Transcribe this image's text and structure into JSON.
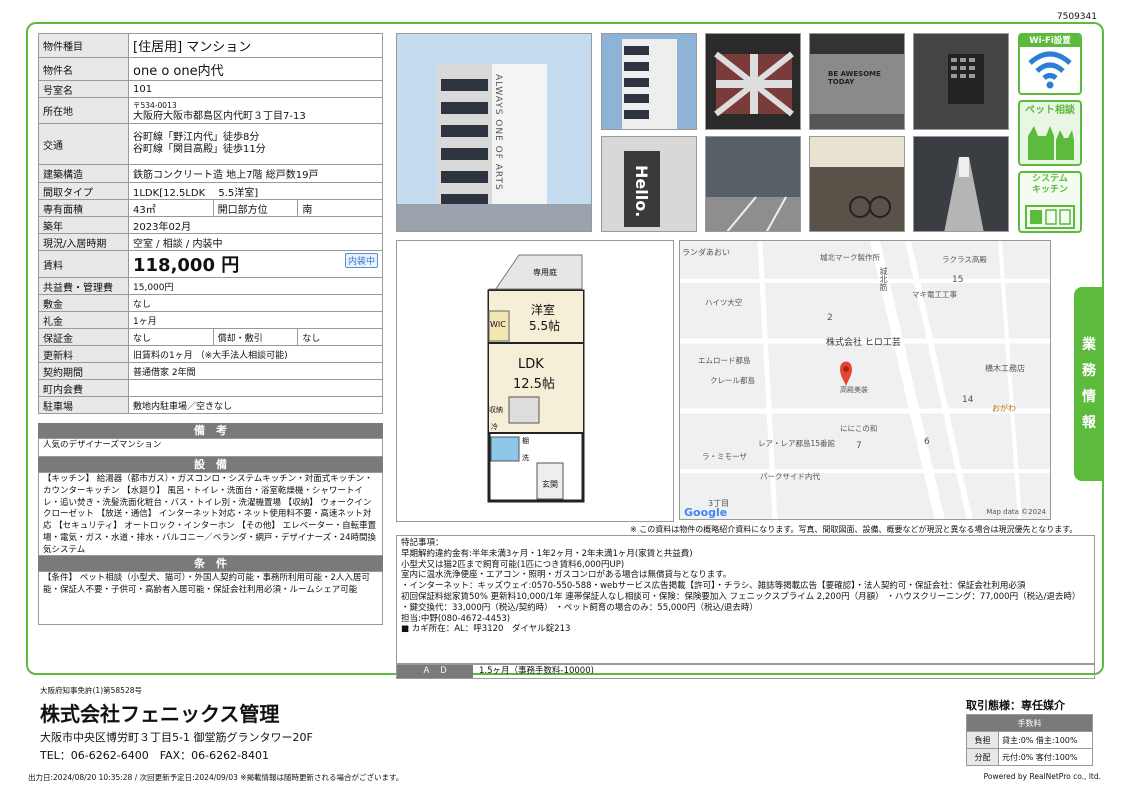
{
  "doc_no": "7509341",
  "spec": {
    "rows": [
      {
        "k": "物件種目",
        "v": "[住居用] マンション"
      },
      {
        "k": "物件名",
        "v": "one o one内代"
      },
      {
        "k": "号室名",
        "v": "101"
      },
      {
        "k": "所在地",
        "v1": "〒534-0013",
        "v2": "大阪府大阪市都島区内代町３丁目7-13"
      },
      {
        "k": "交通",
        "v1": "谷町線「野江内代」徒歩8分",
        "v2": "谷町線「関目高殿」徒歩11分"
      },
      {
        "k": "建築構造",
        "v": "鉄筋コンクリート造 地上7階 総戸数19戸"
      },
      {
        "k": "間取タイプ",
        "v": "1LDK[12.5LDK　 5.5洋室]"
      },
      {
        "k": "専有面積",
        "v": "43㎡",
        "k2": "開口部方位",
        "v2": "南"
      },
      {
        "k": "築年",
        "v": "2023年02月"
      },
      {
        "k": "現況/入居時期",
        "v": "空室 / 相談 / 内装中"
      },
      {
        "k": "賃料",
        "v": "118,000 円",
        "badge": "内装中"
      },
      {
        "k": "共益費・管理費",
        "v": "15,000円"
      },
      {
        "k": "敷金",
        "v": "なし"
      },
      {
        "k": "礼金",
        "v": "1ヶ月"
      },
      {
        "k": "保証金",
        "v": "なし",
        "k2": "償却・敷引",
        "v2": "なし"
      },
      {
        "k": "更新料",
        "v": "旧賃料の1ヶ月 （※大手法人相談可能)"
      },
      {
        "k": "契約期間",
        "v": "普通借家 2年間"
      },
      {
        "k": "町内会費",
        "v": ""
      },
      {
        "k": "駐車場",
        "v": "敷地内駐車場／空きなし"
      }
    ]
  },
  "remarks": {
    "head": "備　考",
    "body": "人気のデザイナーズマンション"
  },
  "facilities": {
    "head": "設　備",
    "body": "【キッチン】 給湯器（都市ガス）・ガスコンロ・システムキッチン・対面式キッチン・カウンターキッチン 【水廻り】 風呂・トイレ・洗面台・浴室乾燥機・シャワートイレ・追い焚き・洗髪洗面化粧台・バス・トイレ別・洗濯機置場 【収納】 ウォークインクローゼット 【放送・通信】 インターネット対応・ネット使用料不要・高速ネット対応 【セキュリティ】 オートロック・インターホン 【その他】 エレベーター・自転車置場・電気・ガス・水道・排水・バルコニー／ベランダ・網戸・デザイナーズ・24時間換気システム"
  },
  "conditions": {
    "head": "条　件",
    "body": "【条件】 ペット相談（小型犬、猫可）・外国人契約可能・事務所利用可能・2人入居可能・保証人不要・子供可・高齢者入居可能・保証会社利用必須・ルームシェア可能"
  },
  "icons": {
    "wifi": "Wi-Fi設置",
    "pet": "ペット相談",
    "kitchen_1": "システム",
    "kitchen_2": "キッチン"
  },
  "floorplan": {
    "garden": "専用庭",
    "western": "洋室",
    "western_size": "5.5帖",
    "ldk": "LDK",
    "ldk_size": "12.5帖",
    "wic": "WIC",
    "storage": "収納",
    "fridge": "冷",
    "closet": "棚",
    "wash": "洗",
    "entrance": "玄関"
  },
  "map": {
    "labels": [
      "ランダあおい",
      "城北マーク製作所",
      "ラクラス高殿",
      "ハイツ大空",
      "マキ電工工事",
      "城北筋",
      "株式会社 ヒロ工芸",
      "エムロード都島",
      "高殿美装",
      "横木工務店",
      "クレール都島",
      "おがわ",
      "ににこの和",
      "レア・レア都島15番館",
      "ラ・ミモーザ",
      "パークサイド内代",
      "3丁目"
    ],
    "numbers": [
      "15",
      "2",
      "14",
      "7",
      "6"
    ],
    "credit": "Map data ©2024",
    "google": "Google"
  },
  "disclaimer": "※ この資料は物件の概略紹介資料になります。写真、間取図面、設備、概要などが現況と異なる場合は現況優先となります。",
  "notes": {
    "title": "特記事項：",
    "lines": [
      "早期解約違約金有:半年未満3ヶ月・1年2ヶ月・2年未満1ヶ月(家賃と共益費)",
      "小型犬又は猫2匹まで飼育可能(1匹につき賃料6,000円UP)",
      "室内に温水洗浄便座・エアコン・照明・ガスコンロがある場合は無償貸与となります。",
      "・インターネット：キッズウェイ:0570-550-588・webサービス広告掲載【許可】・チラシ、雑誌等掲載広告【要確認】・法人契約可・保証会社：保証会社利用必須",
      "初回保証料総家賃50% 更新料10,000/1年 連帯保証人なし相談可・保険：保険要加入 フェニックスプライム 2,200円（月額） ・ハウスクリーニング：77,000円（税込/退去時） ・鍵交換代：33,000円（税込/契約時） ・ペット飼育の場合のみ：55,000円（税込/退去時）",
      "担当:中野(080-4672-4453)",
      "■ カギ所在：AL：呼3120　ダイヤル錠213"
    ]
  },
  "ad": {
    "label": "Ａ　Ｄ",
    "value": "1.5ヶ月（事務手数料-10000)"
  },
  "side_tab": [
    "業",
    "務",
    "情",
    "報"
  ],
  "company": {
    "license": "大阪府知事免許(1)第58528号",
    "name": "株式会社フェニックス管理",
    "address": "大阪市中央区博労町３丁目5-1 御堂筋グランタワー20F",
    "tel": "TEL：06-6262-6400　FAX：06-6262-8401"
  },
  "fee": {
    "title": "取引態様：専任媒介",
    "head": "手数料",
    "rows": [
      {
        "k": "負担",
        "v": "貸主:0% 借主:100%"
      },
      {
        "k": "分配",
        "v": "元付:0% 客付:100%"
      }
    ]
  },
  "footer": {
    "left": "出力日:2024/08/20 10:35:28 / 次回更新予定日:2024/09/03 ※掲載情報は随時更新される場合がございます。",
    "right": "Powered by RealNetPro co., ltd."
  },
  "photo_texts": {
    "building_sign": "ALWAYS ONE OF ARTS",
    "lobby_sign": "BE AWESOME TODAY",
    "hello": "Hello."
  }
}
